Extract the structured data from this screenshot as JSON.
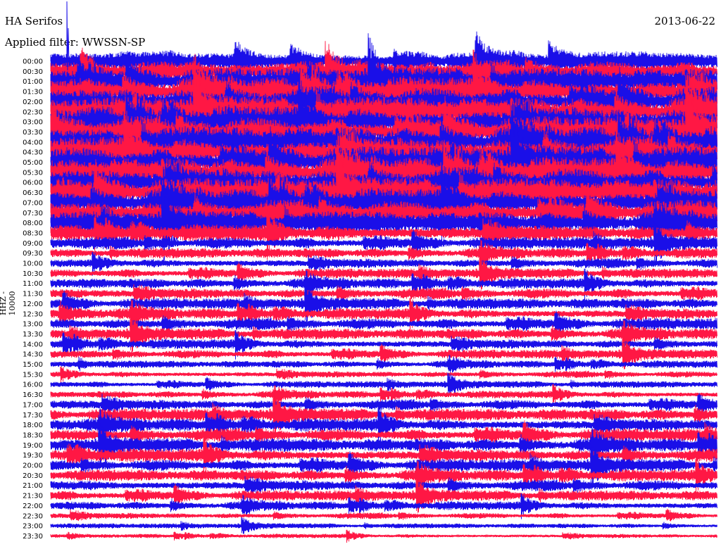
{
  "header": {
    "station": "HA Serifos",
    "date": "2013-06-22",
    "filter": "Applied filter: WWSSN-SP"
  },
  "chart_data": {
    "type": "line",
    "title": "HA Serifos",
    "date": "2013-06-22",
    "filter": "WWSSN-SP",
    "ylabel": "HHZ - 10000",
    "row_labels": [
      "00:00",
      "00:30",
      "01:00",
      "01:30",
      "02:00",
      "02:30",
      "03:00",
      "03:30",
      "04:00",
      "04:30",
      "05:00",
      "05:30",
      "06:00",
      "06:30",
      "07:00",
      "07:30",
      "08:00",
      "08:30",
      "09:00",
      "09:30",
      "10:00",
      "10:30",
      "11:00",
      "11:30",
      "12:00",
      "12:30",
      "13:00",
      "13:30",
      "14:00",
      "14:30",
      "15:00",
      "15:30",
      "16:00",
      "16:30",
      "17:00",
      "17:30",
      "18:00",
      "18:30",
      "19:00",
      "19:30",
      "20:00",
      "20:30",
      "21:00",
      "21:30",
      "22:00",
      "22:30",
      "23:00",
      "23:30"
    ],
    "trace_colors": [
      "#1a0fe8",
      "#ff1744"
    ],
    "relative_amplitude": [
      1.7,
      1.8,
      2.2,
      2.4,
      2.5,
      2.5,
      2.6,
      2.6,
      2.6,
      2.6,
      2.6,
      2.5,
      2.5,
      2.4,
      2.3,
      2.1,
      1.9,
      1.4,
      1.0,
      0.85,
      0.8,
      0.8,
      0.85,
      0.9,
      0.9,
      0.9,
      0.95,
      0.9,
      0.8,
      0.75,
      0.6,
      0.55,
      0.55,
      0.6,
      0.85,
      1.0,
      1.05,
      1.05,
      1.1,
      1.05,
      1.0,
      0.95,
      0.9,
      0.85,
      0.7,
      0.5,
      0.4,
      0.35
    ],
    "grid": false
  }
}
